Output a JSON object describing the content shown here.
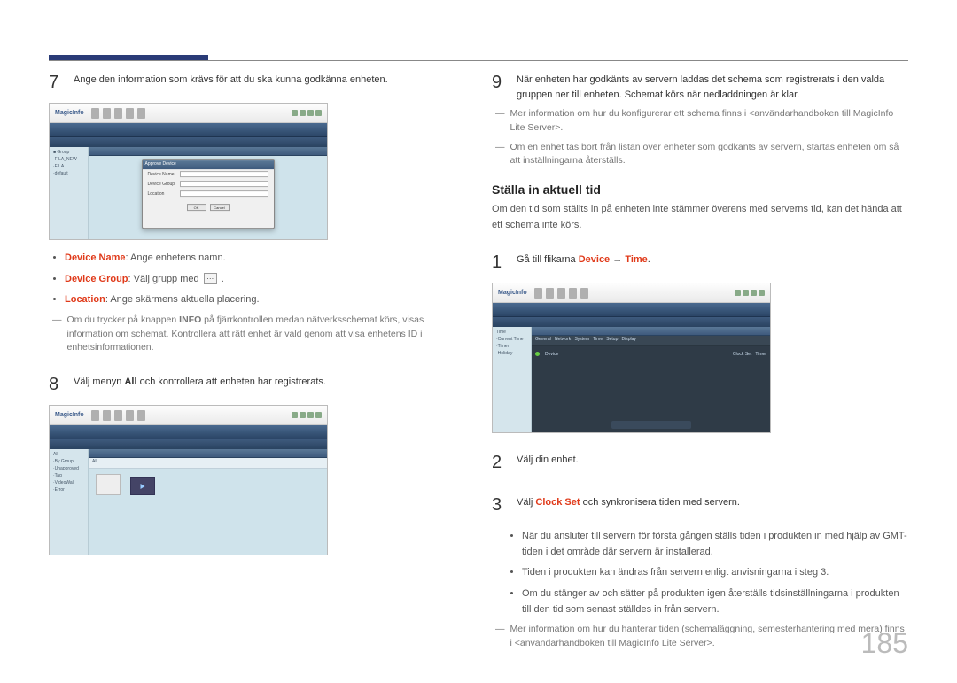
{
  "page_number": "185",
  "left": {
    "step7": {
      "num": "7",
      "text": "Ange den information som krävs för att du ska kunna godkänna enheten."
    },
    "bullets": [
      {
        "kw": "Device Name",
        "rest": ": Ange enhetens namn."
      },
      {
        "kw": "Device Group",
        "rest": ": Välj grupp med "
      },
      {
        "kw": "Location",
        "rest": ": Ange skärmens aktuella placering."
      }
    ],
    "note1_pre": "Om du trycker på knappen ",
    "note1_bold": "INFO",
    "note1_post": " på fjärrkontrollen medan nätverksschemat körs, visas information om schemat. Kontrollera att rätt enhet är vald genom att visa enhetens ID i enhetsinformationen.",
    "step8": {
      "num": "8",
      "pre": "Välj menyn ",
      "bold": "All",
      "post": " och kontrollera att enheten har registrerats."
    }
  },
  "right": {
    "step9": {
      "num": "9",
      "text": "När enheten har godkänts av servern laddas det schema som registrerats i den valda gruppen ner till enheten. Schemat körs när nedladdningen är klar."
    },
    "note_a": "Mer information om hur du konfigurerar ett schema finns i <användarhandboken till MagicInfo Lite Server>.",
    "note_b": "Om en enhet tas bort från listan över enheter som godkänts av servern, startas enheten om så att inställningarna återställs.",
    "section_title": "Ställa in aktuell tid",
    "section_intro": "Om den tid som ställts in på enheten inte stämmer överens med serverns tid, kan det hända att ett schema inte körs.",
    "step1": {
      "num": "1",
      "pre": "Gå till flikarna ",
      "kw1": "Device",
      "arrow": " → ",
      "kw2": "Time",
      "post": "."
    },
    "step2": {
      "num": "2",
      "text": "Välj din enhet."
    },
    "step3": {
      "num": "3",
      "pre": "Välj ",
      "kw": "Clock Set",
      "post": " och synkronisera tiden med servern."
    },
    "sub_bullets": [
      "När du ansluter till servern för första gången ställs tiden i produkten in med hjälp av GMT-tiden i det område där servern är installerad.",
      "Tiden i produkten kan ändras från servern enligt anvisningarna i steg 3.",
      "Om du stänger av och sätter på produkten igen återställs tidsinställningarna i produkten till den tid som senast ställdes in från servern."
    ],
    "note_c": "Mer information om hur du hanterar tiden (schemaläggning, semesterhantering med mera) finns i <användarhandboken till MagicInfo Lite Server>.",
    "ss_logo": "MagicInfo"
  }
}
